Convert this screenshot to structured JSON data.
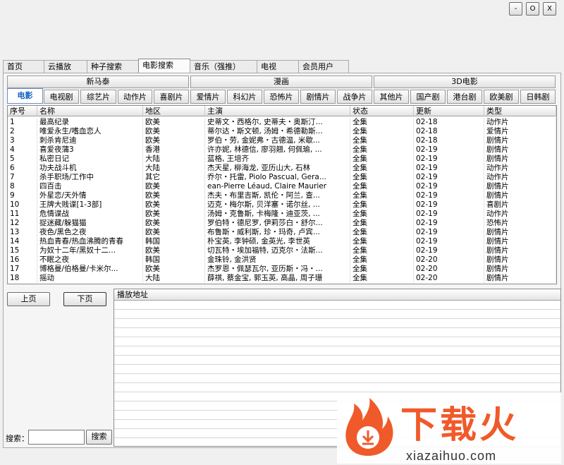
{
  "window": {
    "controls": [
      "-",
      "O",
      "X"
    ]
  },
  "tabs": [
    "首页",
    "云播放",
    "种子搜索",
    "电影搜索",
    "音乐（强推）",
    "电视",
    "会员用户"
  ],
  "active_tab": 3,
  "groups": [
    "新马泰",
    "漫画",
    "3D电影"
  ],
  "categories": [
    "电影",
    "电视剧",
    "综艺片",
    "动作片",
    "喜剧片",
    "爱情片",
    "科幻片",
    "恐怖片",
    "剧情片",
    "战争片",
    "其他片",
    "国产剧",
    "港台剧",
    "欧美剧",
    "日韩剧"
  ],
  "active_category": 0,
  "table": {
    "headers": [
      "序号",
      "名称",
      "地区",
      "主演",
      "状态",
      "更新",
      "类型"
    ],
    "rows": [
      [
        "1",
        "最高纪录",
        "欧美",
        "史蒂文・西格尔, 史蒂夫・奥斯汀...",
        "全集",
        "02-18",
        "动作片"
      ],
      [
        "2",
        "唯爱永生/嗜血恋人",
        "欧美",
        "蒂尔达・斯文顿, 汤姆・希德勒斯...",
        "全集",
        "02-18",
        "爱情片"
      ],
      [
        "3",
        "刺杀肯尼迪",
        "欧美",
        "罗伯・劳, 金妮弗・古德温, 米歇...",
        "全集",
        "02-18",
        "剧情片"
      ],
      [
        "4",
        "喜爱夜蒲3",
        "香港",
        "许亦妮, 林德信, 廖羽翘, 何佩瑜, ...",
        "全集",
        "02-19",
        "剧情片"
      ],
      [
        "5",
        "私密日记",
        "大陆",
        "蓝格, 王培齐",
        "全集",
        "02-19",
        "剧情片"
      ],
      [
        "6",
        "功夫战斗机",
        "大陆",
        "杰天星, 柳海龙, 亚历山大, 石林",
        "全集",
        "02-19",
        "动作片"
      ],
      [
        "7",
        "杀手职场/工作中",
        "其它",
        "乔尔・托雷, Piolo Pascual, Gera...",
        "全集",
        "02-19",
        "动作片"
      ],
      [
        "8",
        "四百击",
        "欧美",
        "ean-Pierre Léaud, Claire Maurier",
        "全集",
        "02-19",
        "剧情片"
      ],
      [
        "9",
        "外星恋/天外情",
        "欧美",
        "杰夫・布里吉斯, 凯伦・阿兰, 查...",
        "全集",
        "02-19",
        "剧情片"
      ],
      [
        "10",
        "王牌大贱谍[1-3部]",
        "欧美",
        "迈克・梅尔斯, 贝洋塞・诺尔丝, ...",
        "全集",
        "02-19",
        "喜剧片"
      ],
      [
        "11",
        "危情谍战",
        "欧美",
        "汤姆・克鲁斯, 卡梅隆・迪亚茨, ...",
        "全集",
        "02-19",
        "动作片"
      ],
      [
        "12",
        "捉迷藏/躲猫猫",
        "欧美",
        "罗伯特・德尼罗, 伊莉莎白・舒尔...",
        "全集",
        "02-19",
        "恐怖片"
      ],
      [
        "13",
        "夜色/黑色之夜",
        "欧美",
        "布鲁斯・威利斯, 珍・玛奇, 卢宾...",
        "全集",
        "02-19",
        "剧情片"
      ],
      [
        "14",
        "热血青春/热血沸腾的青春",
        "韩国",
        "朴宝英, 李钟硕, 金英光, 李世英",
        "全集",
        "02-19",
        "剧情片"
      ],
      [
        "15",
        "为奴十二年/黑奴十二...",
        "欧美",
        "切瓦特・埃加福特, 迈克尔・法斯...",
        "全集",
        "02-19",
        "剧情片"
      ],
      [
        "16",
        "不眠之夜",
        "韩国",
        "金珠铃, 金洪贤",
        "全集",
        "02-20",
        "剧情片"
      ],
      [
        "17",
        "博格曼/伯格曼/卡米尔...",
        "欧美",
        "杰罗恩・佩瑟瓦尔, 亚历斯・冯・...",
        "全集",
        "02-20",
        "剧情片"
      ],
      [
        "18",
        "摇动",
        "大陆",
        "薛祺, 蔡金宝, 郭玉英, 高晶, 周子珊",
        "全集",
        "02-20",
        "剧情片"
      ]
    ]
  },
  "pager": {
    "prev": "上页",
    "next": "下页"
  },
  "play_panel": {
    "title": "播放地址"
  },
  "search": {
    "label": "搜索：",
    "value": "",
    "button": "搜索"
  },
  "watermark": {
    "brand": "下载火",
    "url": "xiazaihuo.com",
    "accent": "#f05a2a"
  }
}
